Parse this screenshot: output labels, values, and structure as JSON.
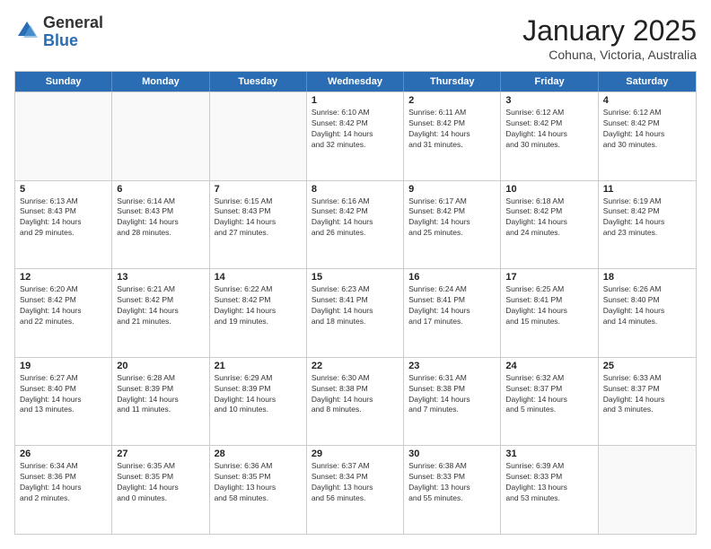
{
  "logo": {
    "general": "General",
    "blue": "Blue"
  },
  "header": {
    "month": "January 2025",
    "location": "Cohuna, Victoria, Australia"
  },
  "days": [
    "Sunday",
    "Monday",
    "Tuesday",
    "Wednesday",
    "Thursday",
    "Friday",
    "Saturday"
  ],
  "weeks": [
    [
      {
        "date": "",
        "info": ""
      },
      {
        "date": "",
        "info": ""
      },
      {
        "date": "",
        "info": ""
      },
      {
        "date": "1",
        "info": "Sunrise: 6:10 AM\nSunset: 8:42 PM\nDaylight: 14 hours\nand 32 minutes."
      },
      {
        "date": "2",
        "info": "Sunrise: 6:11 AM\nSunset: 8:42 PM\nDaylight: 14 hours\nand 31 minutes."
      },
      {
        "date": "3",
        "info": "Sunrise: 6:12 AM\nSunset: 8:42 PM\nDaylight: 14 hours\nand 30 minutes."
      },
      {
        "date": "4",
        "info": "Sunrise: 6:12 AM\nSunset: 8:42 PM\nDaylight: 14 hours\nand 30 minutes."
      }
    ],
    [
      {
        "date": "5",
        "info": "Sunrise: 6:13 AM\nSunset: 8:43 PM\nDaylight: 14 hours\nand 29 minutes."
      },
      {
        "date": "6",
        "info": "Sunrise: 6:14 AM\nSunset: 8:43 PM\nDaylight: 14 hours\nand 28 minutes."
      },
      {
        "date": "7",
        "info": "Sunrise: 6:15 AM\nSunset: 8:43 PM\nDaylight: 14 hours\nand 27 minutes."
      },
      {
        "date": "8",
        "info": "Sunrise: 6:16 AM\nSunset: 8:42 PM\nDaylight: 14 hours\nand 26 minutes."
      },
      {
        "date": "9",
        "info": "Sunrise: 6:17 AM\nSunset: 8:42 PM\nDaylight: 14 hours\nand 25 minutes."
      },
      {
        "date": "10",
        "info": "Sunrise: 6:18 AM\nSunset: 8:42 PM\nDaylight: 14 hours\nand 24 minutes."
      },
      {
        "date": "11",
        "info": "Sunrise: 6:19 AM\nSunset: 8:42 PM\nDaylight: 14 hours\nand 23 minutes."
      }
    ],
    [
      {
        "date": "12",
        "info": "Sunrise: 6:20 AM\nSunset: 8:42 PM\nDaylight: 14 hours\nand 22 minutes."
      },
      {
        "date": "13",
        "info": "Sunrise: 6:21 AM\nSunset: 8:42 PM\nDaylight: 14 hours\nand 21 minutes."
      },
      {
        "date": "14",
        "info": "Sunrise: 6:22 AM\nSunset: 8:42 PM\nDaylight: 14 hours\nand 19 minutes."
      },
      {
        "date": "15",
        "info": "Sunrise: 6:23 AM\nSunset: 8:41 PM\nDaylight: 14 hours\nand 18 minutes."
      },
      {
        "date": "16",
        "info": "Sunrise: 6:24 AM\nSunset: 8:41 PM\nDaylight: 14 hours\nand 17 minutes."
      },
      {
        "date": "17",
        "info": "Sunrise: 6:25 AM\nSunset: 8:41 PM\nDaylight: 14 hours\nand 15 minutes."
      },
      {
        "date": "18",
        "info": "Sunrise: 6:26 AM\nSunset: 8:40 PM\nDaylight: 14 hours\nand 14 minutes."
      }
    ],
    [
      {
        "date": "19",
        "info": "Sunrise: 6:27 AM\nSunset: 8:40 PM\nDaylight: 14 hours\nand 13 minutes."
      },
      {
        "date": "20",
        "info": "Sunrise: 6:28 AM\nSunset: 8:39 PM\nDaylight: 14 hours\nand 11 minutes."
      },
      {
        "date": "21",
        "info": "Sunrise: 6:29 AM\nSunset: 8:39 PM\nDaylight: 14 hours\nand 10 minutes."
      },
      {
        "date": "22",
        "info": "Sunrise: 6:30 AM\nSunset: 8:38 PM\nDaylight: 14 hours\nand 8 minutes."
      },
      {
        "date": "23",
        "info": "Sunrise: 6:31 AM\nSunset: 8:38 PM\nDaylight: 14 hours\nand 7 minutes."
      },
      {
        "date": "24",
        "info": "Sunrise: 6:32 AM\nSunset: 8:37 PM\nDaylight: 14 hours\nand 5 minutes."
      },
      {
        "date": "25",
        "info": "Sunrise: 6:33 AM\nSunset: 8:37 PM\nDaylight: 14 hours\nand 3 minutes."
      }
    ],
    [
      {
        "date": "26",
        "info": "Sunrise: 6:34 AM\nSunset: 8:36 PM\nDaylight: 14 hours\nand 2 minutes."
      },
      {
        "date": "27",
        "info": "Sunrise: 6:35 AM\nSunset: 8:35 PM\nDaylight: 14 hours\nand 0 minutes."
      },
      {
        "date": "28",
        "info": "Sunrise: 6:36 AM\nSunset: 8:35 PM\nDaylight: 13 hours\nand 58 minutes."
      },
      {
        "date": "29",
        "info": "Sunrise: 6:37 AM\nSunset: 8:34 PM\nDaylight: 13 hours\nand 56 minutes."
      },
      {
        "date": "30",
        "info": "Sunrise: 6:38 AM\nSunset: 8:33 PM\nDaylight: 13 hours\nand 55 minutes."
      },
      {
        "date": "31",
        "info": "Sunrise: 6:39 AM\nSunset: 8:33 PM\nDaylight: 13 hours\nand 53 minutes."
      },
      {
        "date": "",
        "info": ""
      }
    ]
  ]
}
